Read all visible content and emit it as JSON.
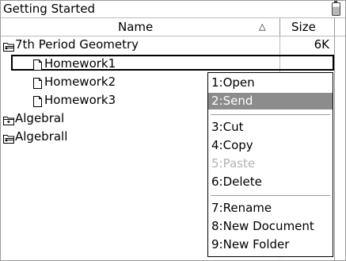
{
  "window": {
    "title": "Getting Started"
  },
  "columns": {
    "name": "Name",
    "size": "Size"
  },
  "files": [
    {
      "type": "folder",
      "name": "7th Period Geometry",
      "size": "6K",
      "expanded": true,
      "indent": 0
    },
    {
      "type": "document",
      "name": "Homework1",
      "size": "",
      "selected": true,
      "indent": 1
    },
    {
      "type": "document",
      "name": "Homework2",
      "size": "",
      "indent": 1
    },
    {
      "type": "document",
      "name": "Homework3",
      "size": "",
      "indent": 1
    },
    {
      "type": "folder",
      "name": "Algebral",
      "size": "",
      "expanded": false,
      "indent": 0
    },
    {
      "type": "folder",
      "name": "Algebrall",
      "size": "",
      "expanded": true,
      "indent": 0
    }
  ],
  "context_menu": {
    "items": [
      {
        "label": "1:Open",
        "state": "normal"
      },
      {
        "label": "2:Send",
        "state": "highlighted"
      },
      {
        "label": "3:Cut",
        "state": "normal"
      },
      {
        "label": "4:Copy",
        "state": "normal"
      },
      {
        "label": "5:Paste",
        "state": "disabled"
      },
      {
        "label": "6:Delete",
        "state": "normal"
      },
      {
        "label": "7:Rename",
        "state": "normal"
      },
      {
        "label": "8:New Document",
        "state": "normal"
      },
      {
        "label": "9:New Folder",
        "state": "normal"
      }
    ]
  },
  "colors": {
    "highlight": "#8c8c8c",
    "disabled_text": "#b3b3b3",
    "border": "#9a9a9a"
  },
  "icons": {
    "battery": "battery-icon",
    "sort": "sort-ascending-icon",
    "folder_open": "folder-open-icon",
    "folder_closed": "folder-closed-icon",
    "document": "document-icon"
  }
}
